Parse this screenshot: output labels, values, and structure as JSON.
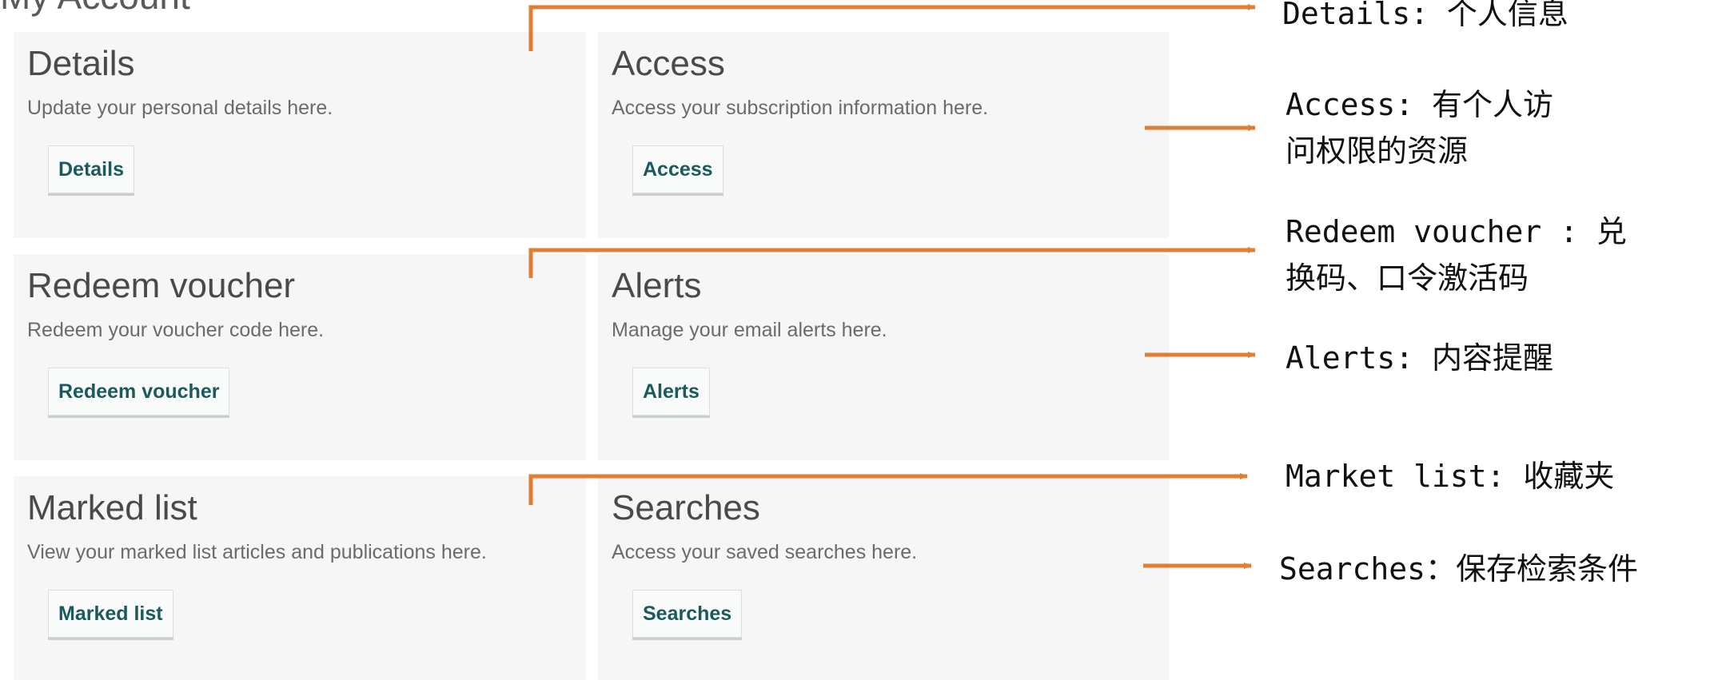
{
  "page": {
    "heading": "My Account"
  },
  "cards": [
    {
      "title": "Details",
      "description": "Update your personal details here.",
      "button": "Details"
    },
    {
      "title": "Access",
      "description": "Access your subscription information here.",
      "button": "Access"
    },
    {
      "title": "Redeem voucher",
      "description": "Redeem your voucher code here.",
      "button": "Redeem voucher"
    },
    {
      "title": "Alerts",
      "description": "Manage your email alerts here.",
      "button": "Alerts"
    },
    {
      "title": "Marked list",
      "description": "View your marked list articles and publications here.",
      "button": "Marked list"
    },
    {
      "title": "Searches",
      "description": "Access your saved searches here.",
      "button": "Searches"
    }
  ],
  "annotations": {
    "details": "Details: 个人信息",
    "access_1": "Access: 有个人访",
    "access_2": "问权限的资源",
    "redeem_1": "Redeem voucher : 兑",
    "redeem_2": "换码、口令激活码",
    "alerts": "Alerts: 内容提醒",
    "marked": "Market list: 收藏夹",
    "searches": "Searches：保存检索条件"
  },
  "colors": {
    "arrow": "#e07f33",
    "button_text": "#1b5a5c",
    "card_bg": "#f6f6f7"
  }
}
